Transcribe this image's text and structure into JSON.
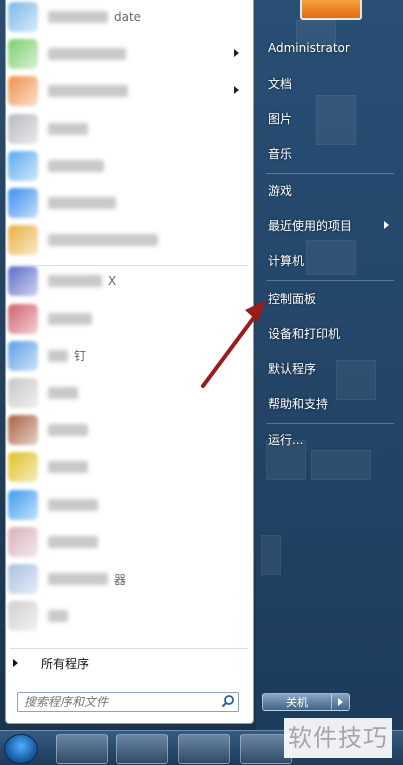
{
  "start_menu": {
    "programs": [
      {
        "icon_color": "#7ab8e8",
        "label_text": "date",
        "has_submenu": false
      },
      {
        "icon_color": "#7ccf6a",
        "label_text": "",
        "has_submenu": true
      },
      {
        "icon_color": "#f0904a",
        "label_text": "",
        "has_submenu": true
      },
      {
        "icon_color": "#b8b8c0",
        "label_text": "",
        "has_submenu": false
      },
      {
        "icon_color": "#5aaaf0",
        "label_text": "",
        "has_submenu": false
      },
      {
        "icon_color": "#3a8ef0",
        "label_text": "",
        "has_submenu": false
      },
      {
        "icon_color": "#e8b040",
        "label_text": "",
        "has_submenu": false
      },
      {
        "icon_color": "#5a6ac8",
        "label_text": "X",
        "has_submenu": false
      },
      {
        "icon_color": "#d0606a",
        "label_text": "",
        "has_submenu": false
      },
      {
        "icon_color": "#5aa0e8",
        "label_text": "钉",
        "has_submenu": false
      },
      {
        "icon_color": "#c8c8c8",
        "label_text": "",
        "has_submenu": false
      },
      {
        "icon_color": "#a86040",
        "label_text": "",
        "has_submenu": false
      },
      {
        "icon_color": "#e0c020",
        "label_text": "",
        "has_submenu": false
      },
      {
        "icon_color": "#3a9af0",
        "label_text": "",
        "has_submenu": false
      },
      {
        "icon_color": "#d8b0b8",
        "label_text": "",
        "has_submenu": false
      },
      {
        "icon_color": "#a8c0e0",
        "label_text": "器",
        "has_submenu": false
      },
      {
        "icon_color": "#d0d0d0",
        "label_text": "",
        "has_submenu": false
      }
    ],
    "all_programs_label": "所有程序",
    "search_placeholder": "搜索程序和文件"
  },
  "right_pane": {
    "user_name": "Administrator",
    "items": {
      "documents": "文档",
      "pictures": "图片",
      "music": "音乐",
      "games": "游戏",
      "recent": "最近使用的项目",
      "computer": "计算机",
      "control_panel": "控制面板",
      "devices": "设备和打印机",
      "default_programs": "默认程序",
      "help": "帮助和支持",
      "run": "运行..."
    },
    "shutdown_label": "关机"
  },
  "annotation": {
    "arrow_color": "#9b1c1c"
  },
  "watermark": "软件技巧"
}
